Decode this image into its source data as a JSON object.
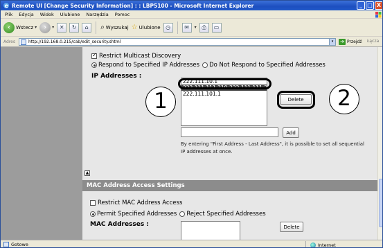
{
  "window": {
    "title": "Remote UI [Change Security Information] : : LBP5100 - Microsoft Internet Explorer",
    "controls": [
      "_",
      "□",
      "X"
    ]
  },
  "menu": [
    "Plik",
    "Edycja",
    "Widok",
    "Ulubione",
    "Narzędzia",
    "Pomoc"
  ],
  "toolbar": {
    "back_label": "Wstecz",
    "search_label": "Wyszukaj",
    "favorites_label": "Ulubione"
  },
  "address_bar": {
    "label": "Adres",
    "url": "http://192.168.0.215/cab/edit_security.shtml",
    "go_label": "Przejdź",
    "links_label": "Łącza"
  },
  "multicast": {
    "restrict_label": "Restrict Multicast Discovery",
    "restrict_checked": true,
    "respond_label": "Respond to Specified IP Addresses",
    "no_respond_label": "Do Not Respond to Specified Addresses",
    "selected_mode": "respond"
  },
  "ip_section": {
    "label": "IP Addresses :",
    "items": [
      "222.111.10.1",
      "222.111.111.210-222.111.111.223",
      "222.111.101.1"
    ],
    "selected_index": 1,
    "delete_label": "Delete",
    "add_label": "Add",
    "add_value": "",
    "note": "By entering \"First Address - Last Address\", it is possible to set all sequential IP addresses at once."
  },
  "mac_section": {
    "header": "MAC Address Access Settings",
    "restrict_label": "Restrict MAC Address Access",
    "restrict_checked": false,
    "permit_label": "Permit Specified Addresses",
    "reject_label": "Reject Specified Addresses",
    "selected_mode": "permit",
    "label": "MAC Addresses :",
    "delete_label": "Delete"
  },
  "callouts": [
    "1",
    "2"
  ],
  "status_bar": {
    "text": "Gotowe",
    "zone": "Internet"
  },
  "colors": {
    "titlebar": "#1d4fbf",
    "sidebar": "#9c9c9c",
    "panel": "#e7e7e7",
    "section_header": "#8c8c8c"
  }
}
